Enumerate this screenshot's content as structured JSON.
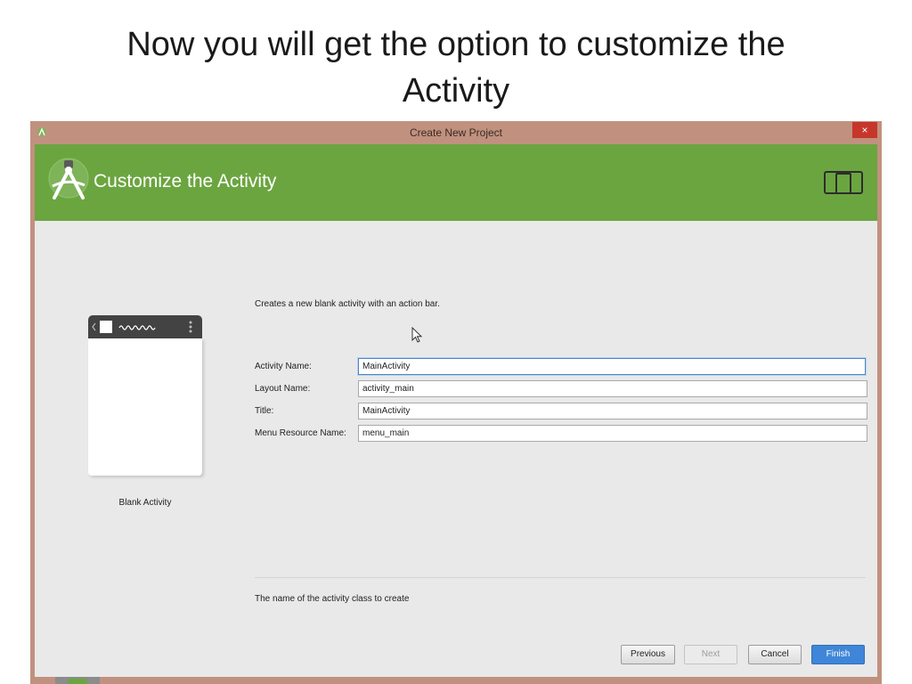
{
  "slide": {
    "title_line1": "Now you will get the option to customize the",
    "title_line2": "Activity"
  },
  "window": {
    "title": "Create New Project",
    "close_label": "×"
  },
  "header": {
    "heading": "Customize the Activity"
  },
  "template": {
    "description": "Creates a new blank activity with an action bar.",
    "preview_label": "Blank Activity"
  },
  "form": {
    "activity_name": {
      "label": "Activity Name:",
      "value": "MainActivity"
    },
    "layout_name": {
      "label": "Layout Name:",
      "value": "activity_main"
    },
    "title": {
      "label": "Title:",
      "value": "MainActivity"
    },
    "menu_resource_name": {
      "label": "Menu Resource Name:",
      "value": "menu_main"
    }
  },
  "hint": "The name of the activity class to create",
  "buttons": {
    "previous": "Previous",
    "next": "Next",
    "cancel": "Cancel",
    "finish": "Finish"
  },
  "colors": {
    "header_green": "#6ba540",
    "window_frame": "#c1917f",
    "primary_button": "#3f86d8",
    "close_button": "#c7362a"
  }
}
